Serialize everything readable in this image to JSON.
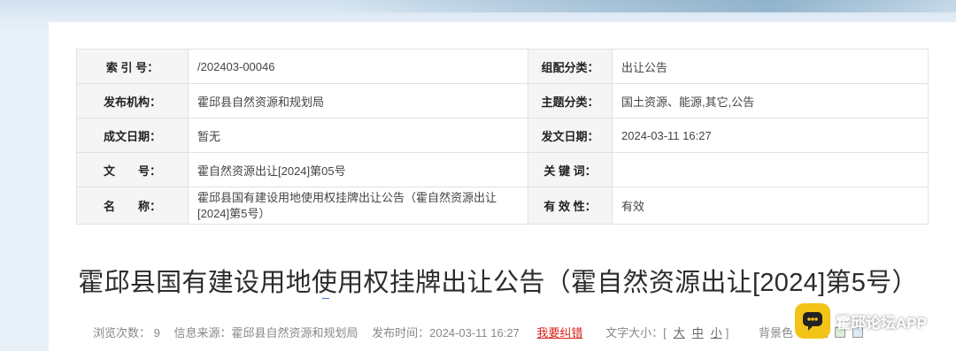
{
  "meta_table": {
    "rows": [
      {
        "l1": "索 引 号：",
        "v1": "/202403-00046",
        "l2": "组配分类：",
        "v2": "出让公告"
      },
      {
        "l1": "发布机构：",
        "v1": "霍邱县自然资源和规划局",
        "l2": "主题分类：",
        "v2": "国土资源、能源,其它,公告"
      },
      {
        "l1": "成文日期：",
        "v1": "暂无",
        "l2": "发文日期：",
        "v2": "2024-03-11 16:27"
      },
      {
        "l1": "文　　号：",
        "v1": "霍自然资源出让[2024]第05号",
        "l2": "关 键 词：",
        "v2": ""
      },
      {
        "l1": "名　　称：",
        "v1": "霍邱县国有建设用地使用权挂牌出让公告（霍自然资源出让[2024]第5号）",
        "l2": "有 效 性：",
        "v2": "有效"
      }
    ]
  },
  "article": {
    "title": "霍邱县国有建设用地使用权挂牌出让公告（霍自然资源出让[2024]第5号）"
  },
  "info_bar": {
    "views": "浏览次数： 9",
    "source": "信息来源：霍邱县自然资源和规划局",
    "publish_time": "发布时间：2024-03-11 16:27",
    "report_error": "我要纠错",
    "font_size_label": "文字大小：[",
    "font_large": "大",
    "font_medium": "中",
    "font_small": "小",
    "font_size_end": "]",
    "bg_color_label": "背景色"
  },
  "watermark": {
    "text": "霍邱论坛APP"
  },
  "colors": {
    "accent": "#3a7bd5",
    "error_link": "#d9231d",
    "watermark_icon": "#f3c318"
  }
}
